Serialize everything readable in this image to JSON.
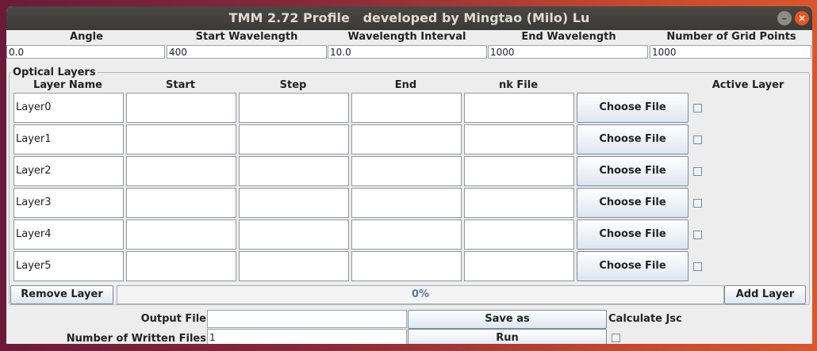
{
  "window": {
    "title": "TMM 2.72 Profile   developed by Mingtao (Milo) Lu",
    "min_symbol": "–",
    "close_symbol": "×"
  },
  "params": {
    "angle_label": "Angle",
    "start_wavelength_label": "Start Wavelength",
    "wavelength_interval_label": "Wavelength Interval",
    "end_wavelength_label": "End Wavelength",
    "grid_points_label": "Number of Grid Points",
    "angle": "0.0",
    "start_wavelength": "400",
    "wavelength_interval": "10.0",
    "end_wavelength": "1000",
    "grid_points": "1000"
  },
  "optical_layers": {
    "group_title": "Optical Layers",
    "headers": {
      "name": "Layer Name",
      "start": "Start",
      "step": "Step",
      "end": "End",
      "nk": "nk File",
      "active": "Active Layer"
    },
    "choose_label": "Choose File",
    "layers": [
      {
        "name": "Layer0",
        "start": "",
        "step": "",
        "end": "",
        "nk": "",
        "active": false
      },
      {
        "name": "Layer1",
        "start": "",
        "step": "",
        "end": "",
        "nk": "",
        "active": false
      },
      {
        "name": "Layer2",
        "start": "",
        "step": "",
        "end": "",
        "nk": "",
        "active": false
      },
      {
        "name": "Layer3",
        "start": "",
        "step": "",
        "end": "",
        "nk": "",
        "active": false
      },
      {
        "name": "Layer4",
        "start": "",
        "step": "",
        "end": "",
        "nk": "",
        "active": false
      },
      {
        "name": "Layer5",
        "start": "",
        "step": "",
        "end": "",
        "nk": "",
        "active": false
      }
    ]
  },
  "controls": {
    "remove_layer_label": "Remove Layer",
    "add_layer_label": "Add Layer",
    "progress_text": "0%",
    "progress_fraction": 0
  },
  "output": {
    "output_file_label": "Output File",
    "output_file_value": "",
    "save_as_label": "Save as",
    "calculate_jsc_label": "Calculate Jsc",
    "calculate_jsc_checked": false,
    "written_files_label": "Number of Written Files",
    "written_files_value": "1",
    "run_label": "Run"
  },
  "colors": {
    "accent": "#e95420",
    "button_top": "#ffffff",
    "button_bottom": "#dce6f0",
    "progress_text": "#5577aa"
  }
}
